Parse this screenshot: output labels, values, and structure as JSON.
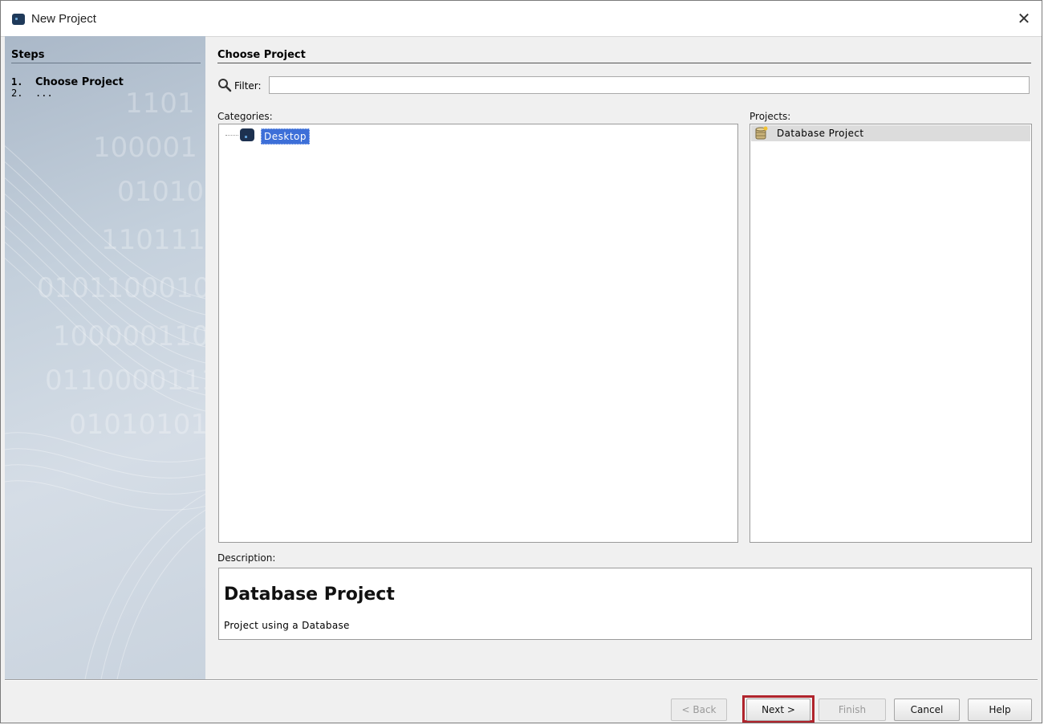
{
  "window": {
    "title": "New Project",
    "close_glyph": "✕"
  },
  "steps": {
    "title": "Steps",
    "items": [
      {
        "num": "1.",
        "label": "Choose Project"
      },
      {
        "num": "2.",
        "label": "..."
      }
    ]
  },
  "main": {
    "section_title": "Choose Project",
    "filter": {
      "label": "Filter:",
      "value": "",
      "placeholder": ""
    },
    "categories": {
      "label": "Categories:",
      "items": [
        {
          "label": "Desktop",
          "selected": true,
          "icon": "desktop-app-icon"
        }
      ]
    },
    "projects": {
      "label": "Projects:",
      "items": [
        {
          "label": "Database Project",
          "selected": true,
          "icon": "database-project-icon"
        }
      ]
    },
    "description": {
      "label": "Description:",
      "title": "Database Project",
      "text": "Project using a Database"
    }
  },
  "buttons": {
    "back": "< Back",
    "next": "Next >",
    "finish": "Finish",
    "cancel": "Cancel",
    "help": "Help"
  },
  "colors": {
    "selection": "#3d6fd8",
    "highlight_border": "#b0242c",
    "steps_panel": "#c4d0dc"
  }
}
